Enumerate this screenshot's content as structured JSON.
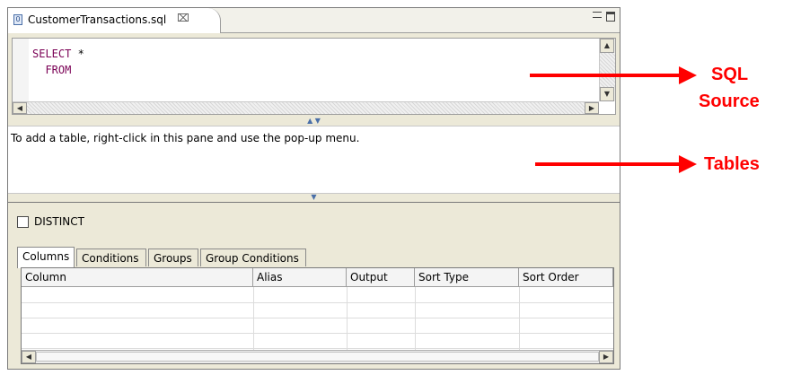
{
  "editor": {
    "tab_label": "CustomerTransactions.sql",
    "tab_close_glyph": "⌧",
    "sql": {
      "keyword_select": "SELECT",
      "select_rest": " *",
      "keyword_from": "FROM"
    },
    "tables_hint": "To add a table, right-click in this pane and use the pop-up menu.",
    "distinct_label": "DISTINCT",
    "distinct_checked": false,
    "tabs": [
      {
        "label": "Columns",
        "active": true
      },
      {
        "label": "Conditions",
        "active": false
      },
      {
        "label": "Groups",
        "active": false
      },
      {
        "label": "Group Conditions",
        "active": false
      }
    ],
    "grid": {
      "columns": [
        "Column",
        "Alias",
        "Output",
        "Sort Type",
        "Sort Order"
      ],
      "rows": [
        [
          "",
          "",
          "",
          "",
          ""
        ],
        [
          "",
          "",
          "",
          "",
          ""
        ],
        [
          "",
          "",
          "",
          "",
          ""
        ],
        [
          "",
          "",
          "",
          "",
          ""
        ]
      ]
    }
  },
  "annotations": {
    "sql_source_line1": "SQL",
    "sql_source_line2": "Source",
    "tables": "Tables",
    "color": "#ff0000"
  }
}
